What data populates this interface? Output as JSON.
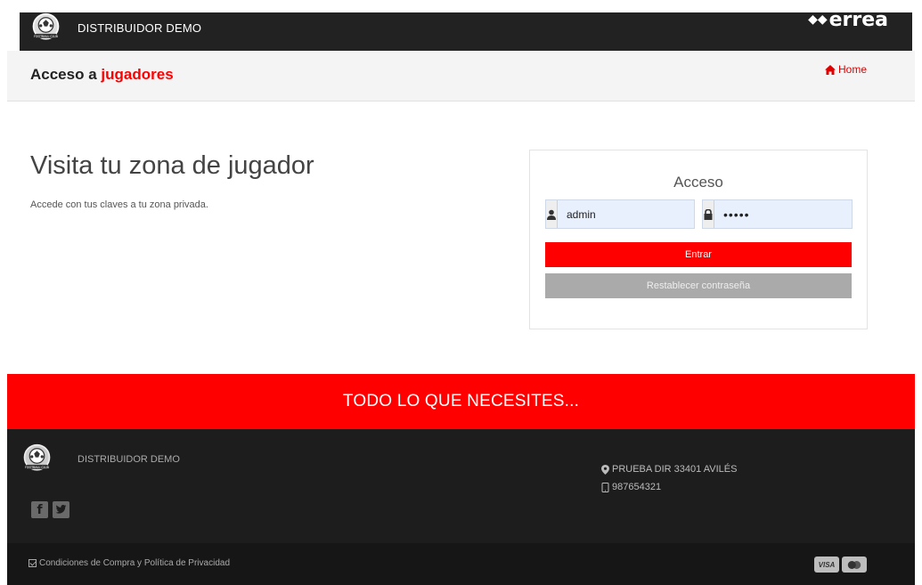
{
  "header": {
    "brand_name": "DISTRIBUIDOR DEMO",
    "partner_logo": "errea",
    "partner_logo_mark": "◆◆",
    "logo_text": "FOOTBALL CLUB"
  },
  "page_header": {
    "title_prefix": "Acceso a",
    "title_accent": "jugadores",
    "breadcrumb_home": "Home"
  },
  "main": {
    "hero_title": "Visita tu zona de jugador",
    "hero_subtitle": "Accede con tus claves a tu zona privada."
  },
  "login": {
    "title": "Acceso",
    "username_value": "admin",
    "password_value": "•••••",
    "enter_label": "Entrar",
    "reset_label": "Restablecer contraseña"
  },
  "promo": {
    "text": "TODO LO QUE NECESITES..."
  },
  "footer": {
    "brand_name": "DISTRIBUIDOR DEMO",
    "address": "PRUEBA DIR 33401 AVILÉS",
    "phone": "987654321",
    "social": [
      "facebook",
      "twitter"
    ],
    "legal": "Condiciones de Compra y Política de Privacidad",
    "payment": [
      "VISA",
      "mastercard"
    ]
  },
  "colors": {
    "accent": "#ff0000",
    "topbar": "#222222",
    "footer": "#1d1d1d"
  }
}
